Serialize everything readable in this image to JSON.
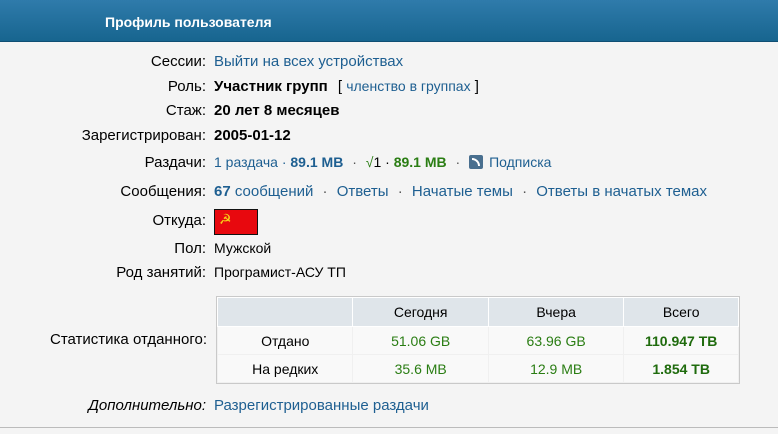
{
  "header": {
    "title": "Профиль пользователя"
  },
  "profile": {
    "sessions": {
      "label": "Сессии:",
      "link": "Выйти на всех устройствах"
    },
    "role": {
      "label": "Роль:",
      "value": "Участник групп",
      "bracket_open": "[",
      "link": "членство в группах",
      "bracket_close": "]"
    },
    "tenure": {
      "label": "Стаж:",
      "value": "20 лет 8 месяцев"
    },
    "registered": {
      "label": "Зарегистрирован:",
      "value": "2005-01-12"
    },
    "releases": {
      "label": "Раздачи:",
      "count_link": "1 раздача",
      "dot1": "·",
      "size1": "89.1 MB",
      "dot2": "·",
      "check": "√",
      "check_count": "1",
      "dot3": "·",
      "size2": "89.1 MB",
      "dot4": "·",
      "subscribe": "Подписка"
    },
    "messages": {
      "label": "Сообщения:",
      "count": "67",
      "count_link": "сообщений",
      "dot": "·",
      "replies": "Ответы",
      "started": "Начатые темы",
      "replies_in_started": "Ответы в начатых темах"
    },
    "from": {
      "label": "Откуда:",
      "flag_symbol": "☭"
    },
    "gender": {
      "label": "Пол:",
      "value": "Мужской"
    },
    "occupation": {
      "label": "Род занятий:",
      "value": "Програмист-АСУ ТП"
    },
    "stats": {
      "label": "Статистика отданного:",
      "headers": [
        "",
        "Сегодня",
        "Вчера",
        "Всего"
      ],
      "rows": [
        {
          "name": "Отдано",
          "today": "51.06 GB",
          "yesterday": "63.96 GB",
          "total": "110.947 TB"
        },
        {
          "name": "На редких",
          "today": "35.6 MB",
          "yesterday": "12.9 MB",
          "total": "1.854 TB"
        }
      ]
    },
    "additional": {
      "label": "Дополнительно:",
      "link": "Разрегистрированные раздачи"
    }
  },
  "colors": {
    "header": "#1e6d9b",
    "link": "#1e5f91",
    "green": "#2a7d13",
    "flag": "#e8080e"
  }
}
